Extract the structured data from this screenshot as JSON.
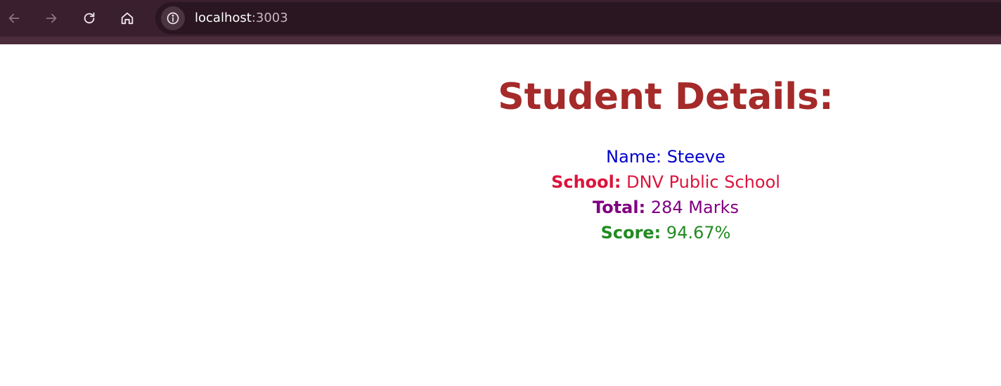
{
  "browser": {
    "url_host": "localhost",
    "url_port": ":3003",
    "icons": [
      "back-arrow-icon",
      "forward-arrow-icon",
      "reload-icon",
      "home-icon",
      "info-icon"
    ]
  },
  "page": {
    "heading": "Student Details:",
    "name_label": "Name:",
    "name_value": "Steeve",
    "school_label": "School:",
    "school_value": "DNV Public School",
    "total_label": "Total:",
    "total_value": "284 Marks",
    "score_label": "Score:",
    "score_value": "94.67%"
  },
  "colors": {
    "heading": "#a52a2a",
    "name": "#0000cd",
    "school": "#dc143c",
    "total": "#800080",
    "score": "#228b22",
    "browser_bar": "#3a1f2e"
  }
}
